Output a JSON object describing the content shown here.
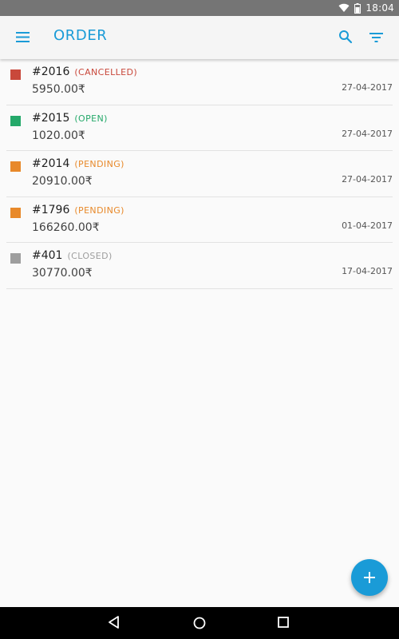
{
  "status_bar": {
    "time": "18:04"
  },
  "app_bar": {
    "title": "ORDER"
  },
  "colors": {
    "accent": "#1a9bd7",
    "cancelled": "#c9483b",
    "open": "#25a96a",
    "pending": "#e8892a",
    "closed": "#9e9e9e"
  },
  "orders": [
    {
      "number": "#2016",
      "status": "(CANCELLED)",
      "status_key": "cancelled",
      "amount": "5950.00₹",
      "date": "27-04-2017"
    },
    {
      "number": "#2015",
      "status": "(OPEN)",
      "status_key": "open",
      "amount": "1020.00₹",
      "date": "27-04-2017"
    },
    {
      "number": "#2014",
      "status": "(PENDING)",
      "status_key": "pending",
      "amount": "20910.00₹",
      "date": "27-04-2017"
    },
    {
      "number": "#1796",
      "status": "(PENDING)",
      "status_key": "pending",
      "amount": "166260.00₹",
      "date": "01-04-2017"
    },
    {
      "number": "#401",
      "status": "(CLOSED)",
      "status_key": "closed",
      "amount": "30770.00₹",
      "date": "17-04-2017"
    }
  ],
  "icons": {
    "menu": "menu-icon",
    "search": "search-icon",
    "filter": "filter-icon",
    "add": "plus-icon"
  }
}
